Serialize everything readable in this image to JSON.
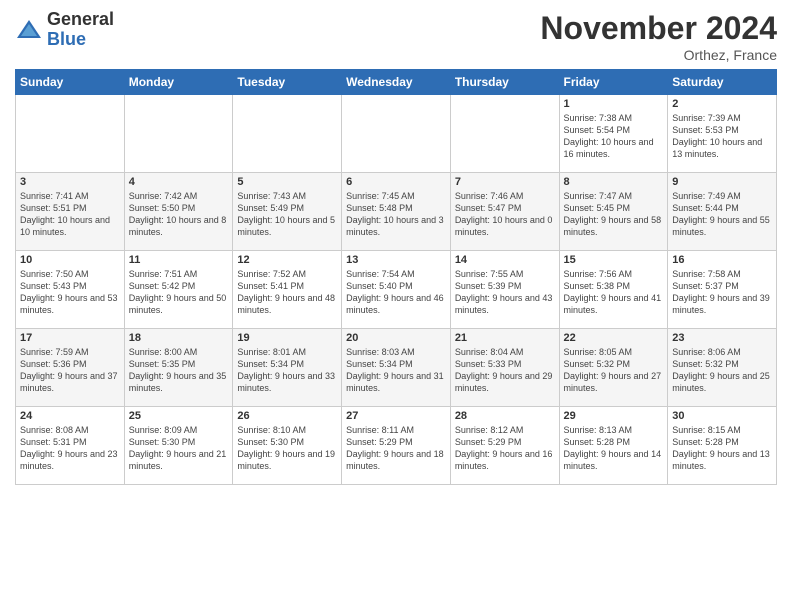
{
  "logo": {
    "general": "General",
    "blue": "Blue"
  },
  "title": "November 2024",
  "location": "Orthez, France",
  "days_of_week": [
    "Sunday",
    "Monday",
    "Tuesday",
    "Wednesday",
    "Thursday",
    "Friday",
    "Saturday"
  ],
  "weeks": [
    [
      {
        "day": "",
        "info": ""
      },
      {
        "day": "",
        "info": ""
      },
      {
        "day": "",
        "info": ""
      },
      {
        "day": "",
        "info": ""
      },
      {
        "day": "",
        "info": ""
      },
      {
        "day": "1",
        "info": "Sunrise: 7:38 AM\nSunset: 5:54 PM\nDaylight: 10 hours and 16 minutes."
      },
      {
        "day": "2",
        "info": "Sunrise: 7:39 AM\nSunset: 5:53 PM\nDaylight: 10 hours and 13 minutes."
      }
    ],
    [
      {
        "day": "3",
        "info": "Sunrise: 7:41 AM\nSunset: 5:51 PM\nDaylight: 10 hours and 10 minutes."
      },
      {
        "day": "4",
        "info": "Sunrise: 7:42 AM\nSunset: 5:50 PM\nDaylight: 10 hours and 8 minutes."
      },
      {
        "day": "5",
        "info": "Sunrise: 7:43 AM\nSunset: 5:49 PM\nDaylight: 10 hours and 5 minutes."
      },
      {
        "day": "6",
        "info": "Sunrise: 7:45 AM\nSunset: 5:48 PM\nDaylight: 10 hours and 3 minutes."
      },
      {
        "day": "7",
        "info": "Sunrise: 7:46 AM\nSunset: 5:47 PM\nDaylight: 10 hours and 0 minutes."
      },
      {
        "day": "8",
        "info": "Sunrise: 7:47 AM\nSunset: 5:45 PM\nDaylight: 9 hours and 58 minutes."
      },
      {
        "day": "9",
        "info": "Sunrise: 7:49 AM\nSunset: 5:44 PM\nDaylight: 9 hours and 55 minutes."
      }
    ],
    [
      {
        "day": "10",
        "info": "Sunrise: 7:50 AM\nSunset: 5:43 PM\nDaylight: 9 hours and 53 minutes."
      },
      {
        "day": "11",
        "info": "Sunrise: 7:51 AM\nSunset: 5:42 PM\nDaylight: 9 hours and 50 minutes."
      },
      {
        "day": "12",
        "info": "Sunrise: 7:52 AM\nSunset: 5:41 PM\nDaylight: 9 hours and 48 minutes."
      },
      {
        "day": "13",
        "info": "Sunrise: 7:54 AM\nSunset: 5:40 PM\nDaylight: 9 hours and 46 minutes."
      },
      {
        "day": "14",
        "info": "Sunrise: 7:55 AM\nSunset: 5:39 PM\nDaylight: 9 hours and 43 minutes."
      },
      {
        "day": "15",
        "info": "Sunrise: 7:56 AM\nSunset: 5:38 PM\nDaylight: 9 hours and 41 minutes."
      },
      {
        "day": "16",
        "info": "Sunrise: 7:58 AM\nSunset: 5:37 PM\nDaylight: 9 hours and 39 minutes."
      }
    ],
    [
      {
        "day": "17",
        "info": "Sunrise: 7:59 AM\nSunset: 5:36 PM\nDaylight: 9 hours and 37 minutes."
      },
      {
        "day": "18",
        "info": "Sunrise: 8:00 AM\nSunset: 5:35 PM\nDaylight: 9 hours and 35 minutes."
      },
      {
        "day": "19",
        "info": "Sunrise: 8:01 AM\nSunset: 5:34 PM\nDaylight: 9 hours and 33 minutes."
      },
      {
        "day": "20",
        "info": "Sunrise: 8:03 AM\nSunset: 5:34 PM\nDaylight: 9 hours and 31 minutes."
      },
      {
        "day": "21",
        "info": "Sunrise: 8:04 AM\nSunset: 5:33 PM\nDaylight: 9 hours and 29 minutes."
      },
      {
        "day": "22",
        "info": "Sunrise: 8:05 AM\nSunset: 5:32 PM\nDaylight: 9 hours and 27 minutes."
      },
      {
        "day": "23",
        "info": "Sunrise: 8:06 AM\nSunset: 5:32 PM\nDaylight: 9 hours and 25 minutes."
      }
    ],
    [
      {
        "day": "24",
        "info": "Sunrise: 8:08 AM\nSunset: 5:31 PM\nDaylight: 9 hours and 23 minutes."
      },
      {
        "day": "25",
        "info": "Sunrise: 8:09 AM\nSunset: 5:30 PM\nDaylight: 9 hours and 21 minutes."
      },
      {
        "day": "26",
        "info": "Sunrise: 8:10 AM\nSunset: 5:30 PM\nDaylight: 9 hours and 19 minutes."
      },
      {
        "day": "27",
        "info": "Sunrise: 8:11 AM\nSunset: 5:29 PM\nDaylight: 9 hours and 18 minutes."
      },
      {
        "day": "28",
        "info": "Sunrise: 8:12 AM\nSunset: 5:29 PM\nDaylight: 9 hours and 16 minutes."
      },
      {
        "day": "29",
        "info": "Sunrise: 8:13 AM\nSunset: 5:28 PM\nDaylight: 9 hours and 14 minutes."
      },
      {
        "day": "30",
        "info": "Sunrise: 8:15 AM\nSunset: 5:28 PM\nDaylight: 9 hours and 13 minutes."
      }
    ]
  ]
}
